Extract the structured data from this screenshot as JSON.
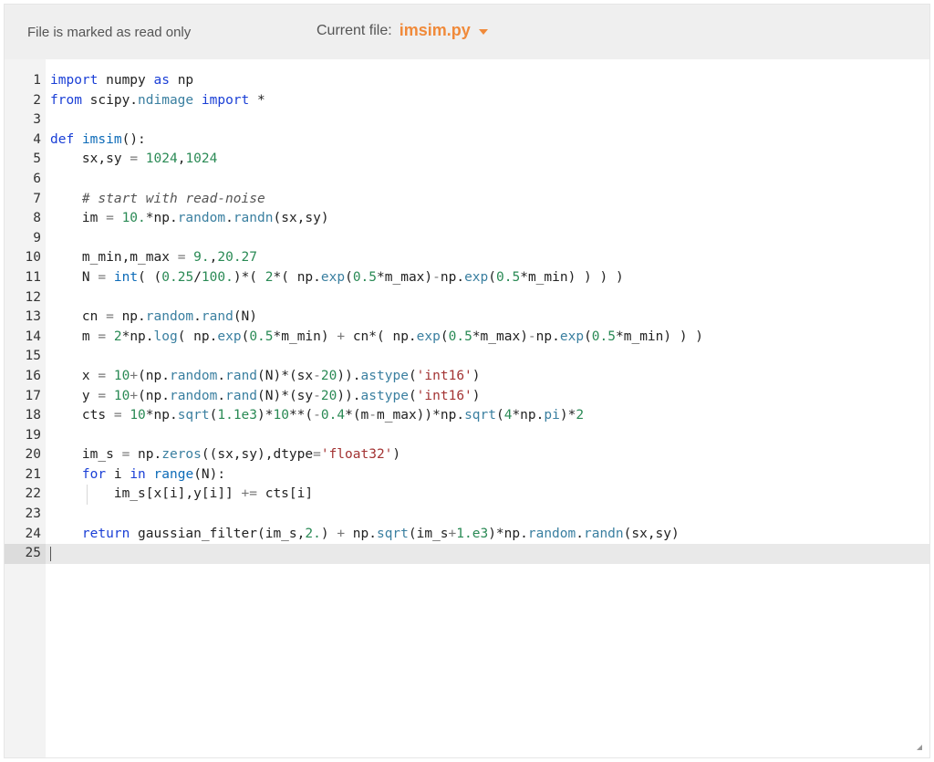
{
  "topbar": {
    "readonly_text": "File is marked as read only",
    "current_file_label": "Current file:",
    "current_file_name": "imsim.py"
  },
  "colors": {
    "accent": "#f08a3a",
    "keyword": "#1a3fd6",
    "function": "#0d6bb8",
    "number": "#2a8a55",
    "string": "#a33333"
  },
  "editor": {
    "active_line": 25,
    "lines": [
      {
        "n": "1",
        "code": "import numpy as np"
      },
      {
        "n": "2",
        "code": "from scipy.ndimage import *"
      },
      {
        "n": "3",
        "code": ""
      },
      {
        "n": "4",
        "code": "def imsim():"
      },
      {
        "n": "5",
        "code": "    sx,sy = 1024,1024"
      },
      {
        "n": "6",
        "code": ""
      },
      {
        "n": "7",
        "code": "    # start with read-noise"
      },
      {
        "n": "8",
        "code": "    im = 10.*np.random.randn(sx,sy)"
      },
      {
        "n": "9",
        "code": ""
      },
      {
        "n": "10",
        "code": "    m_min,m_max = 9.,20.27"
      },
      {
        "n": "11",
        "code": "    N = int( (0.25/100.)*( 2*( np.exp(0.5*m_max)-np.exp(0.5*m_min) ) ) )"
      },
      {
        "n": "12",
        "code": ""
      },
      {
        "n": "13",
        "code": "    cn = np.random.rand(N)"
      },
      {
        "n": "14",
        "code": "    m = 2*np.log( np.exp(0.5*m_min) + cn*( np.exp(0.5*m_max)-np.exp(0.5*m_min) ) )"
      },
      {
        "n": "15",
        "code": ""
      },
      {
        "n": "16",
        "code": "    x = 10+(np.random.rand(N)*(sx-20)).astype('int16')"
      },
      {
        "n": "17",
        "code": "    y = 10+(np.random.rand(N)*(sy-20)).astype('int16')"
      },
      {
        "n": "18",
        "code": "    cts = 10*np.sqrt(1.1e3)*10**(-0.4*(m-m_max))*np.sqrt(4*np.pi)*2"
      },
      {
        "n": "19",
        "code": ""
      },
      {
        "n": "20",
        "code": "    im_s = np.zeros((sx,sy),dtype='float32')"
      },
      {
        "n": "21",
        "code": "    for i in range(N):"
      },
      {
        "n": "22",
        "code": "        im_s[x[i],y[i]] += cts[i]"
      },
      {
        "n": "23",
        "code": ""
      },
      {
        "n": "24",
        "code": "    return gaussian_filter(im_s,2.) + np.sqrt(im_s+1.e3)*np.random.randn(sx,sy)"
      },
      {
        "n": "25",
        "code": ""
      }
    ]
  }
}
